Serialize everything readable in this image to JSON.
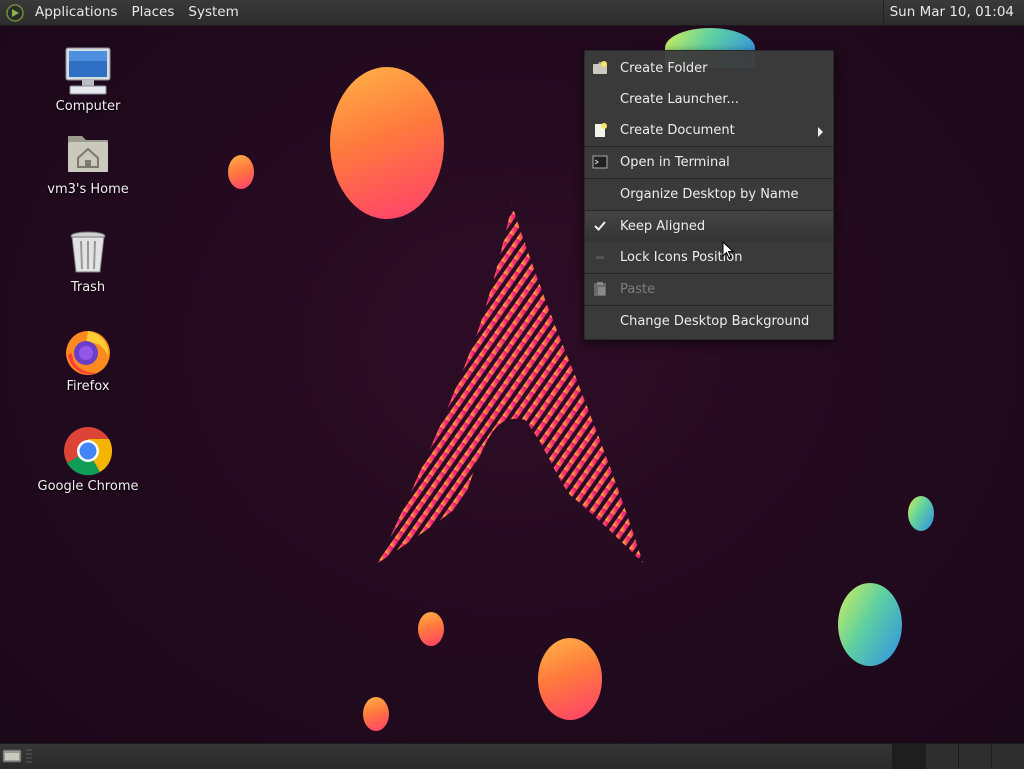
{
  "top_panel": {
    "menus": [
      "Applications",
      "Places",
      "System"
    ],
    "clock": "Sun Mar 10, 01:04"
  },
  "desktop_icons": [
    {
      "label": "Computer",
      "icon": "computer-icon"
    },
    {
      "label": "vm3's Home",
      "icon": "home-folder-icon"
    },
    {
      "label": "Trash",
      "icon": "trash-icon"
    },
    {
      "label": "Firefox",
      "icon": "firefox-icon"
    },
    {
      "label": "Google Chrome",
      "icon": "chrome-icon"
    }
  ],
  "context_menu": {
    "items": [
      {
        "label": "Create Folder",
        "icon": "folder-new-icon"
      },
      {
        "label": "Create Launcher...",
        "icon": ""
      },
      {
        "label": "Create Document",
        "icon": "document-new-icon",
        "submenu": true
      },
      {
        "label": "Open in Terminal",
        "icon": "terminal-icon"
      },
      {
        "label": "Organize Desktop by Name",
        "icon": ""
      },
      {
        "label": "Keep Aligned",
        "icon": "checkmark-icon",
        "checked": true
      },
      {
        "label": "Lock Icons Position",
        "icon": "unchecked-icon",
        "checked": false
      },
      {
        "label": "Paste",
        "icon": "paste-icon",
        "disabled": true
      },
      {
        "label": "Change Desktop Background",
        "icon": ""
      }
    ]
  },
  "colors": {
    "desktop_bg": "#220a1e",
    "panel_bg": "#2f2f2f",
    "menu_bg": "#3c3c3c",
    "accent_orange": "#ff7a3d",
    "accent_pink": "#ff3d6e"
  }
}
